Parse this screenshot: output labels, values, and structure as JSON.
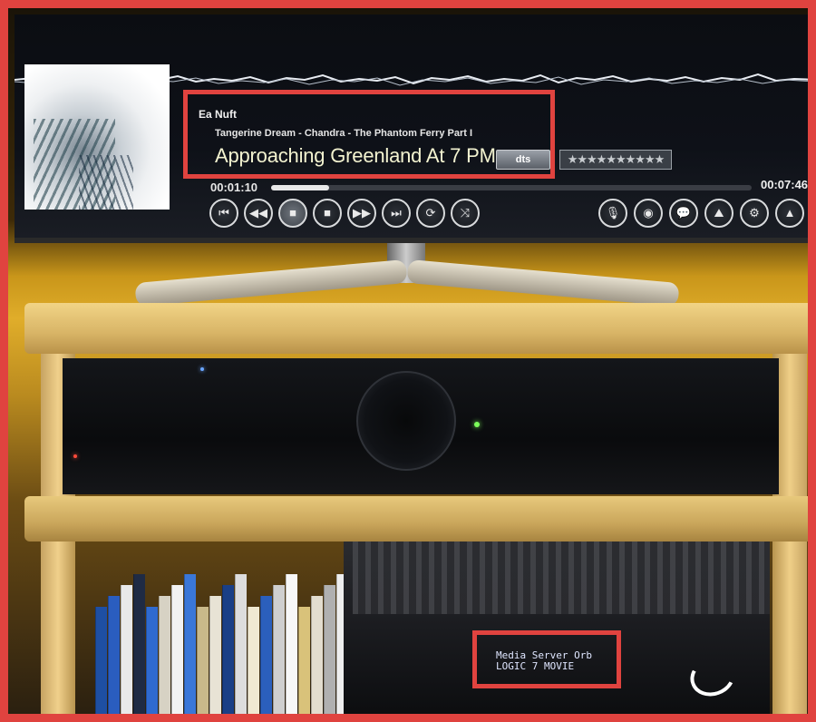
{
  "now_playing": {
    "artist": "Ea Nuft",
    "album_line": "Tangerine Dream - Chandra - The Phantom Ferry Part I",
    "title": "Approaching Greenland At 7 PM",
    "codec_badge": "dts",
    "rating_stars": "★★★★★★★★★★",
    "elapsed": "00:01:10",
    "remaining": "00:07:46",
    "progress_fraction": 0.12
  },
  "controls": {
    "left": [
      {
        "name": "previous-track-icon",
        "glyph": "⏮"
      },
      {
        "name": "rewind-icon",
        "glyph": "◀◀"
      },
      {
        "name": "pause-icon",
        "glyph": "■"
      },
      {
        "name": "stop-icon",
        "glyph": "■"
      },
      {
        "name": "fast-forward-icon",
        "glyph": "▶▶"
      },
      {
        "name": "next-track-icon",
        "glyph": "⏭"
      },
      {
        "name": "repeat-icon",
        "glyph": "⟳"
      },
      {
        "name": "shuffle-icon",
        "glyph": "⤨"
      }
    ],
    "right": [
      {
        "name": "microphone-icon",
        "glyph": "🎙"
      },
      {
        "name": "visualization-icon",
        "glyph": "◉"
      },
      {
        "name": "lyrics-icon",
        "glyph": "💬"
      },
      {
        "name": "fanart-icon",
        "glyph": "⛰"
      },
      {
        "name": "settings-icon",
        "glyph": "⚙"
      },
      {
        "name": "image-icon",
        "glyph": "▲"
      }
    ]
  },
  "front_panel": {
    "line1": "Media Server Orb",
    "line2": "LOGIC 7 MOVIE"
  },
  "colors": {
    "highlight_box": "#e0433f"
  }
}
